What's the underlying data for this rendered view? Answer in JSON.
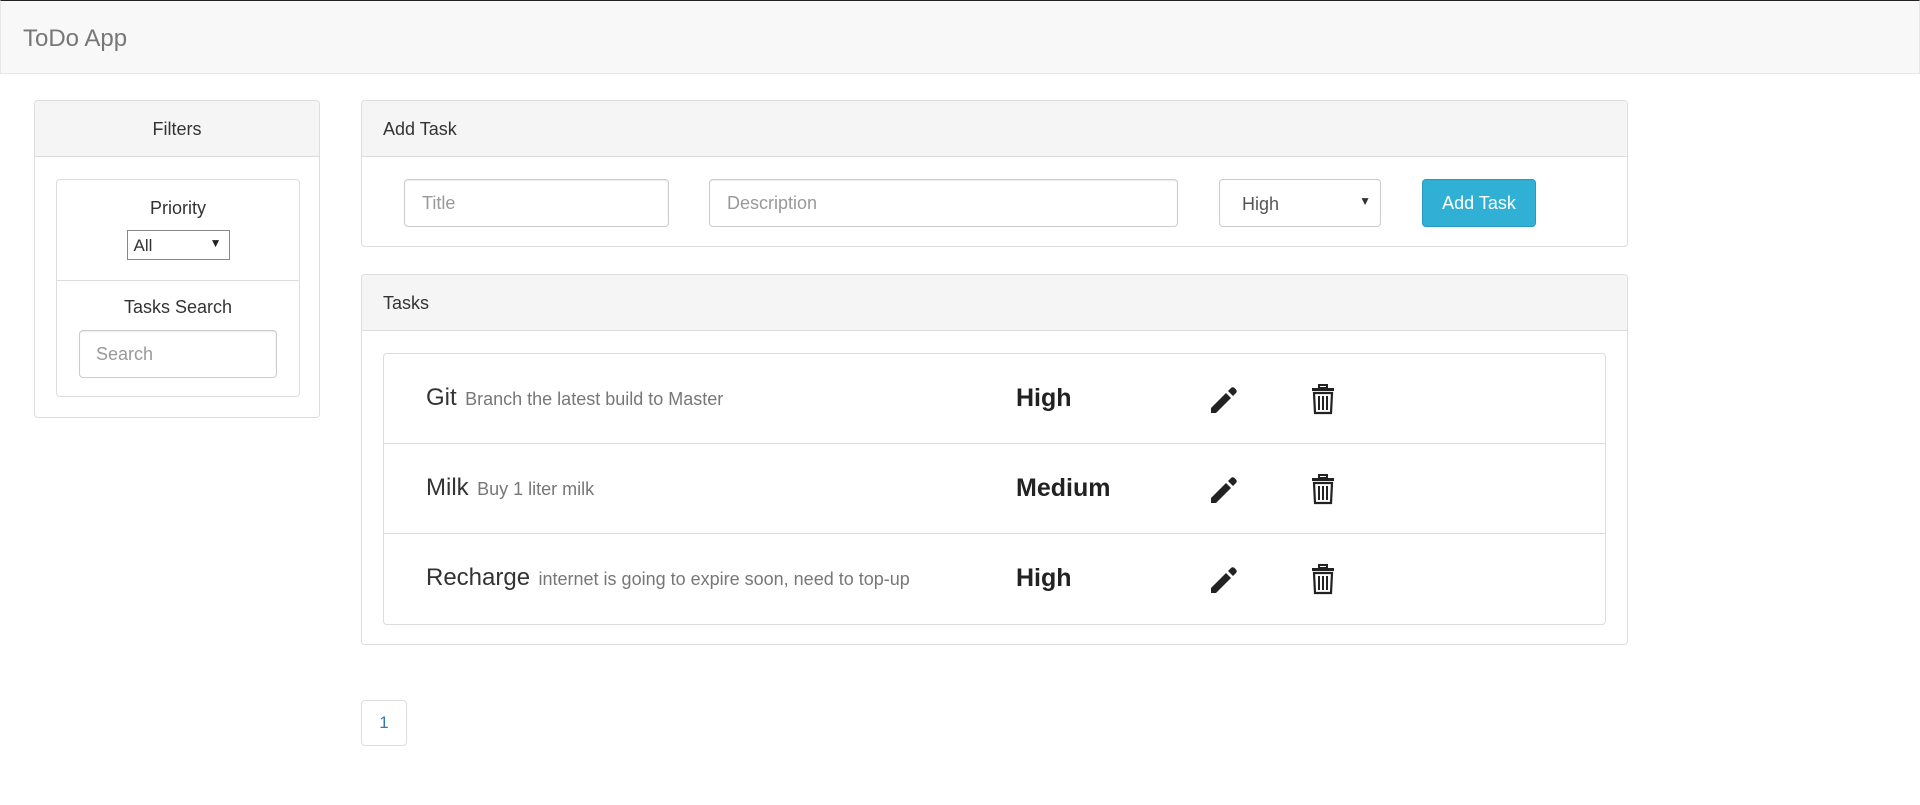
{
  "navbar": {
    "brand": "ToDo App"
  },
  "filters": {
    "heading": "Filters",
    "priority_label": "Priority",
    "priority_selected": "All",
    "search_label": "Tasks Search",
    "search_placeholder": "Search",
    "search_value": ""
  },
  "add_task": {
    "heading": "Add Task",
    "title_placeholder": "Title",
    "title_value": "",
    "description_placeholder": "Description",
    "description_value": "",
    "priority_selected": "High",
    "button_label": "Add Task",
    "button_color": "#31b0d5"
  },
  "tasks": {
    "heading": "Tasks",
    "items": [
      {
        "title": "Git",
        "description": "Branch the latest build to Master",
        "priority": "High"
      },
      {
        "title": "Milk",
        "description": "Buy 1 liter milk",
        "priority": "Medium"
      },
      {
        "title": "Recharge",
        "description": "internet is going to expire soon, need to top-up",
        "priority": "High"
      }
    ],
    "row_icons": [
      "pencil-icon",
      "trash-icon"
    ]
  },
  "pagination": {
    "current_page": "1",
    "link_color": "#337ab7"
  }
}
